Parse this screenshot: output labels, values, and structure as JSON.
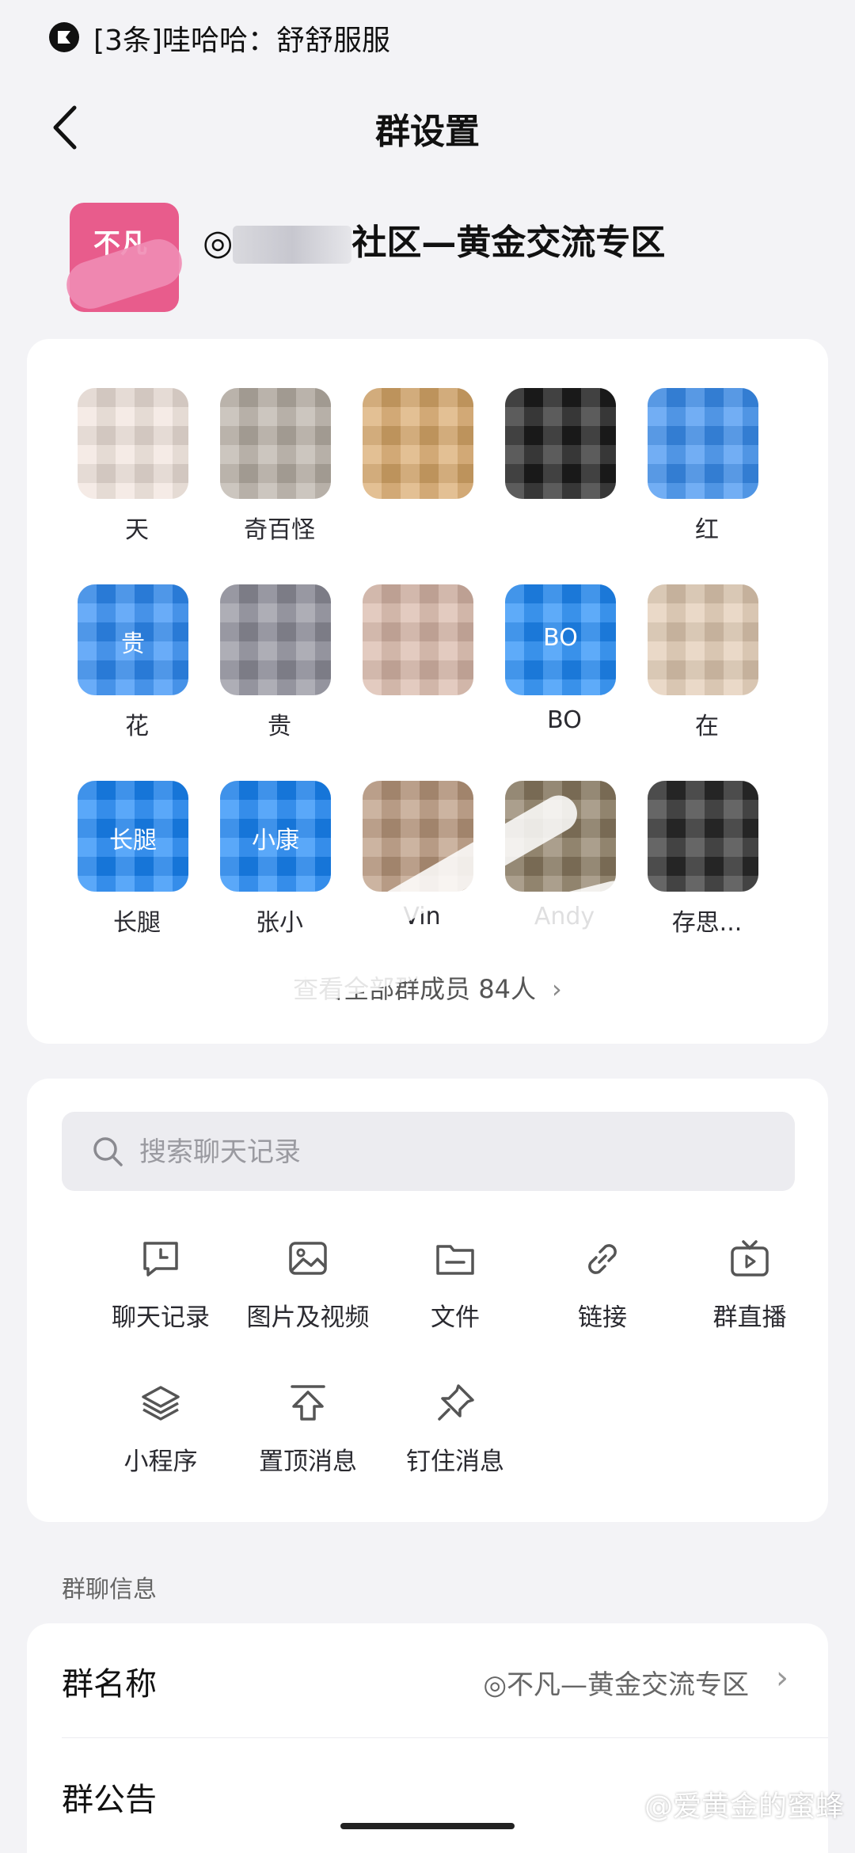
{
  "status_bar": {
    "notification_text": "[3条]哇哈哈：舒舒服服"
  },
  "nav": {
    "title": "群设置",
    "back_icon": "chevron-left-icon"
  },
  "group": {
    "avatar_text": "不凡",
    "name_visible": "社区—黄金交流专区",
    "name_prefix": "◎"
  },
  "members": [
    {
      "name": "天",
      "avatar_color": "#f1e4dc"
    },
    {
      "name": "奇百怪",
      "avatar_color": "#b9b0a6"
    },
    {
      "name": "",
      "avatar_color": "#d9a86a"
    },
    {
      "name": "",
      "avatar_color": "#1d1d1d"
    },
    {
      "name": "红",
      "avatar_color": "#3b8ff0"
    },
    {
      "name": "花",
      "avatar_color": "#2f8cf5",
      "avatar_text": "贵"
    },
    {
      "name": "贵",
      "avatar_color": "#8e8e9a"
    },
    {
      "name": "",
      "avatar_color": "#d8b7a8"
    },
    {
      "name": "BO",
      "avatar_color": "#1f8af7",
      "avatar_text": "BO"
    },
    {
      "name": "在",
      "avatar_color": "#e2cbb3"
    },
    {
      "name": "长腿",
      "avatar_color": "#1a86f7",
      "avatar_text": "长腿"
    },
    {
      "name": "张小",
      "avatar_color": "#1a86f7",
      "avatar_text": "小康"
    },
    {
      "name": "Vin",
      "avatar_color": "#b9977c"
    },
    {
      "name": "Andy",
      "avatar_color": "#8a7a60"
    },
    {
      "name": "存思...",
      "avatar_color": "#2b2b2b"
    }
  ],
  "view_all_text": "查看全部群成员 84人",
  "search": {
    "placeholder": "搜索聊天记录"
  },
  "tools": [
    {
      "label": "聊天记录",
      "icon": "chat-history-icon"
    },
    {
      "label": "图片及视频",
      "icon": "image-icon"
    },
    {
      "label": "文件",
      "icon": "folder-icon"
    },
    {
      "label": "链接",
      "icon": "link-icon"
    },
    {
      "label": "群直播",
      "icon": "tv-live-icon"
    },
    {
      "label": "小程序",
      "icon": "layers-icon"
    },
    {
      "label": "置顶消息",
      "icon": "pin-top-icon"
    },
    {
      "label": "钉住消息",
      "icon": "thumbtack-icon"
    }
  ],
  "info_section": {
    "title": "群聊信息",
    "rows": [
      {
        "label": "群名称",
        "value": "◎不凡—黄金交流专区"
      },
      {
        "label": "群公告",
        "value": ""
      }
    ]
  },
  "watermark": "@爱黄金的蜜蜂"
}
